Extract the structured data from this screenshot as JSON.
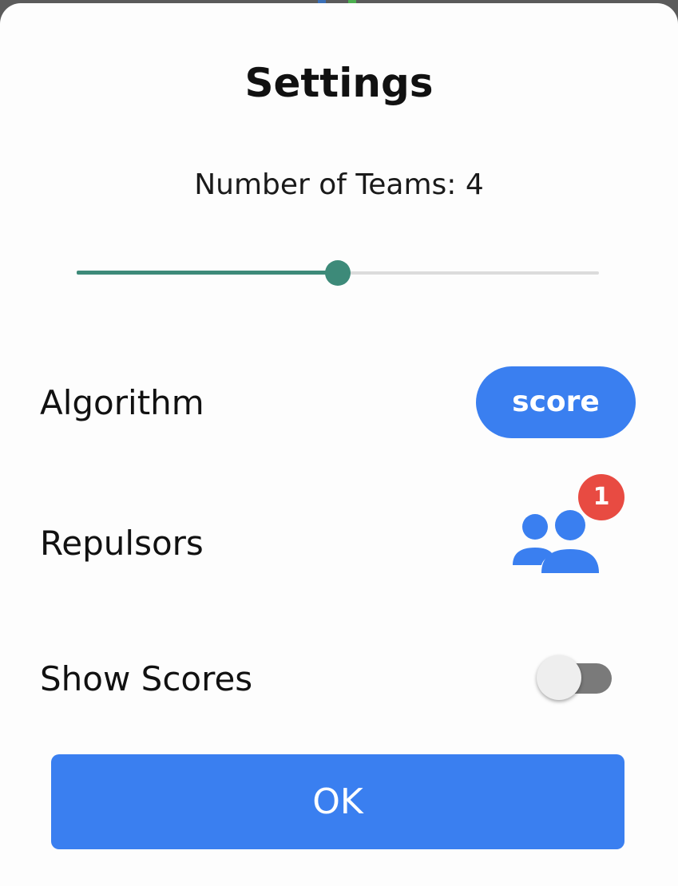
{
  "dialog": {
    "title": "Settings"
  },
  "teams": {
    "label": "Number of Teams: 4",
    "slider_fraction": 0.5
  },
  "algorithm": {
    "label": "Algorithm",
    "value": "score"
  },
  "repulsors": {
    "label": "Repulsors",
    "icon": "people-group-icon",
    "badge_count": "1"
  },
  "show_scores": {
    "label": "Show Scores",
    "enabled": false
  },
  "actions": {
    "ok_label": "OK"
  },
  "colors": {
    "accent_blue": "#3a7ff0",
    "slider_green": "#3d8a79",
    "badge_red": "#e84b42",
    "toggle_off_track": "#7a7a7a"
  }
}
